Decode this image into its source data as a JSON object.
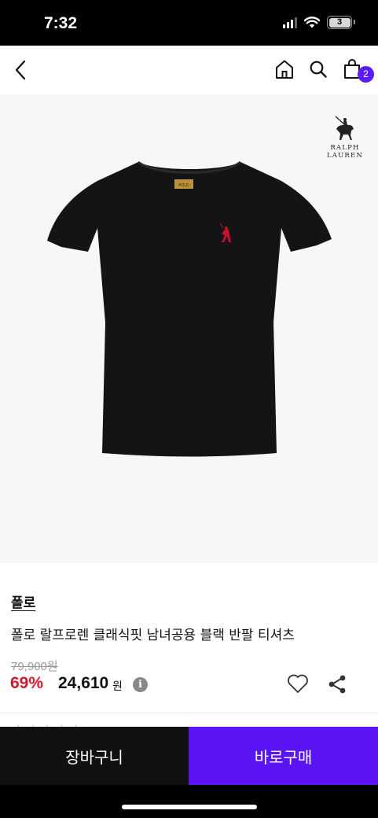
{
  "status_bar": {
    "time": "7:32",
    "battery": "3"
  },
  "nav": {
    "cart_count": "2"
  },
  "product": {
    "logo_line1": "RALPH",
    "logo_line2": "LAUREN",
    "label_text": "POLO",
    "brand": "폴로",
    "title": "폴로 랄프로렌 클래식핏 남녀공용 블랙 반팔 티셔츠",
    "original_price": "79,900원",
    "discount": "69%",
    "sale_price": "24,610",
    "currency": "원",
    "shirt_color": "#141414",
    "logo_color": "#c8102e"
  },
  "actions": {
    "cart_label": "장바구니",
    "buy_label": "바로구매"
  },
  "colors": {
    "accent": "#5b14f5",
    "sale_red": "#d5172e"
  }
}
